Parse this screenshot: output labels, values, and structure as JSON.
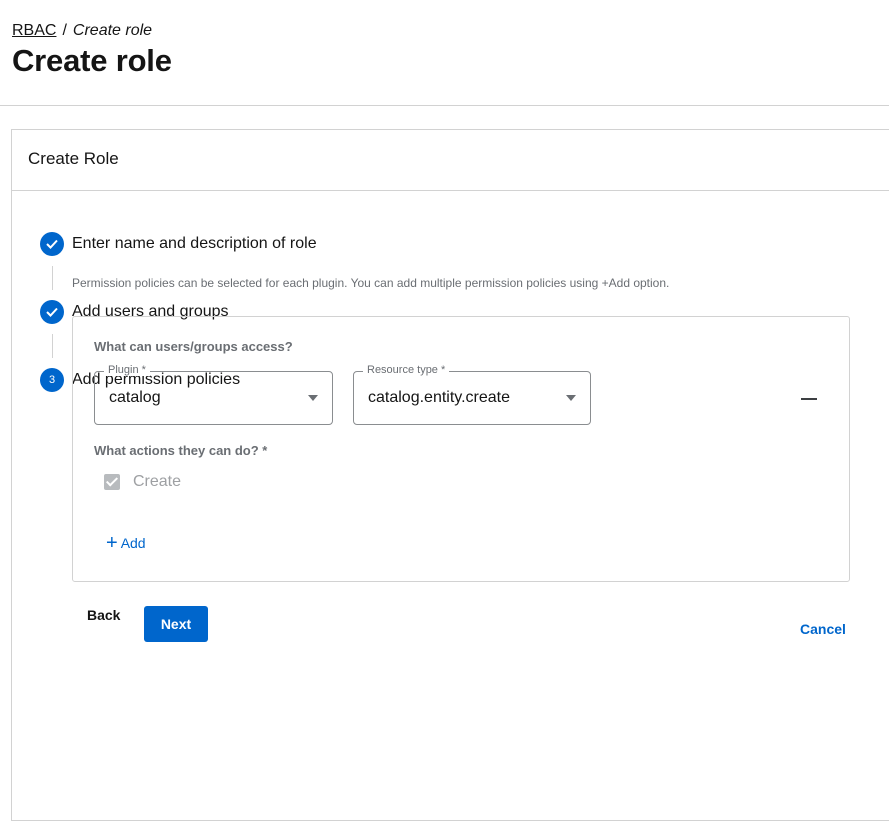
{
  "breadcrumb": {
    "parent": "RBAC",
    "separator": "/",
    "current": "Create role"
  },
  "page_title": "Create role",
  "card": {
    "title": "Create Role"
  },
  "steps": [
    {
      "label": "Enter name and description of role",
      "status": "completed",
      "icon": "check-icon"
    },
    {
      "label": "Add users and groups",
      "status": "completed",
      "icon": "check-icon"
    },
    {
      "label": "Add permission policies",
      "status": "active",
      "number": "3"
    }
  ],
  "step3_description": "Permission policies can be selected for each plugin. You can add multiple permission policies using +Add option.",
  "policy": {
    "heading": "What can users/groups access?",
    "plugin": {
      "label": "Plugin *",
      "value": "catalog"
    },
    "resource_type": {
      "label": "Resource type *",
      "value": "catalog.entity.create"
    },
    "actions_heading": "What actions they can do? *",
    "actions": [
      {
        "label": "Create",
        "checked": true,
        "disabled": true
      }
    ],
    "add_label": "Add"
  },
  "buttons": {
    "back": "Back",
    "next": "Next",
    "cancel": "Cancel"
  },
  "colors": {
    "primary": "#0066cc",
    "border": "#d2d2d2",
    "muted": "#6a6e73"
  }
}
